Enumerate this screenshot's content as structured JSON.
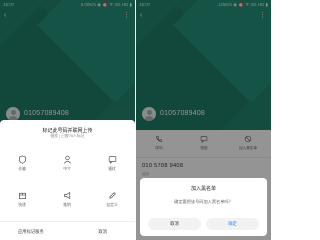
{
  "left_screen": {
    "status_bar": {
      "time": "15:07",
      "indicators": "0.00K/s ◉ ⏰ ᯤ 4G HD ▮"
    },
    "phone_number": "01057089408",
    "sheet": {
      "title": "标记此号码并联网上传",
      "subtitle": "骚扰 | 已被78人标记",
      "items": [
        {
          "label": "诈骗",
          "icon": "shield-icon"
        },
        {
          "label": "中介",
          "icon": "person-icon"
        },
        {
          "label": "骚扰",
          "icon": "chat-icon"
        },
        {
          "label": "快递",
          "icon": "package-icon"
        },
        {
          "label": "推销",
          "icon": "megaphone-icon"
        },
        {
          "label": "自定义",
          "icon": "edit-icon"
        }
      ],
      "footer_left": "应用标记服务",
      "footer_right": "取消"
    }
  },
  "right_screen": {
    "status_bar": {
      "time": "15:07",
      "indicators": "125K/s ◉ ⏰ ᯤ 4G HD ▮"
    },
    "phone_number": "01057089408",
    "actions": [
      {
        "label": "呼叫",
        "icon": "phone-icon"
      },
      {
        "label": "短信",
        "icon": "message-icon"
      },
      {
        "label": "加入黑名单",
        "icon": "block-icon"
      }
    ],
    "detail_number": "010 5708 9408",
    "detail_sub": "北京",
    "dialog": {
      "title": "加入黑名单",
      "message": "确定要把该号码加入黑名单吗？",
      "cancel": "取消",
      "ok": "确定"
    }
  },
  "colors": {
    "header_teal": "#23856f",
    "link_blue": "#2e8ef0"
  }
}
